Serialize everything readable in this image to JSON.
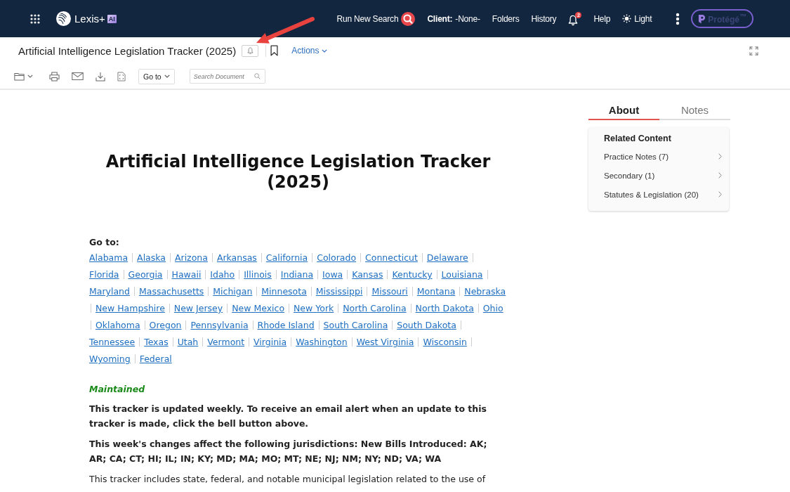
{
  "top_nav": {
    "brand": "Lexis+",
    "brand_badge": "AI",
    "items": [
      {
        "kind": "search",
        "label": "Run New Search"
      },
      {
        "kind": "client",
        "label": "**Client:** -None-"
      },
      {
        "kind": "link",
        "label": "Folders"
      },
      {
        "kind": "link",
        "label": "History"
      },
      {
        "kind": "notifications",
        "badge": "2"
      },
      {
        "kind": "link",
        "label": "Help"
      },
      {
        "kind": "theme",
        "label": "Light"
      },
      {
        "kind": "more"
      }
    ],
    "assistant_button": {
      "label": "Protégé$^{™}$"
    }
  },
  "document_header": {
    "title": "Artificial Intelligence Legislation Tracker (2025)",
    "actions_label": "Actions"
  },
  "toolbar": {
    "goto_label": "Go to",
    "search": {
      "placeholder": "Search Document"
    }
  },
  "document": {
    "title": "Artificial Intelligence Legislation Tracker (2025)",
    "goto_label": "Go to:",
    "jurisdictions": [
      "Alabama",
      "Alaska",
      "Arizona",
      "Arkansas",
      "California",
      "Colorado",
      "Connecticut",
      "Delaware",
      "Florida",
      "Georgia",
      "Hawaii",
      "Idaho",
      "Illinois",
      "Indiana",
      "Iowa",
      "Kansas",
      "Kentucky",
      "Louisiana",
      "Maryland",
      "Massachusetts",
      "Michigan",
      "Minnesota",
      "Mississippi",
      "Missouri",
      "Montana",
      "Nebraska",
      "New Hampshire",
      "New Jersey",
      "New Mexico",
      "New York",
      "North Carolina",
      "North Dakota",
      "Ohio",
      "Oklahoma",
      "Oregon",
      "Pennsylvania",
      "Rhode Island",
      "South Carolina",
      "South Dakota",
      "Tennessee",
      "Texas",
      "Utah",
      "Vermont",
      "Virginia",
      "Washington",
      "West Virginia",
      "Wisconsin",
      "Wyoming",
      "Federal"
    ],
    "status": "Maintained",
    "paragraphs": [
      {
        "kind": "notice",
        "text": "This tracker is updated weekly. To receive an email alert when an update to this tracker is made, click the bell button above."
      },
      {
        "kind": "notice",
        "text": "This week's changes affect the following jurisdictions: New Bills Introduced: AK; AR; CA; CT; HI; IL; IN; KY; MD; MA; MO; MT; NE; NJ; NM; NY; ND; VA; WA"
      },
      {
        "kind": "body",
        "text": "This tracker includes state, federal, and notable municipal legislation related to the use of"
      }
    ]
  },
  "side_panel": {
    "tabs": [
      {
        "label": "About",
        "selected": true
      },
      {
        "label": "Notes",
        "selected": false
      }
    ],
    "related_content": {
      "heading": "Related Content",
      "items": [
        "Practice Notes (7)",
        "Secondary (1)",
        "Statutes & Legislation (20)"
      ]
    }
  }
}
